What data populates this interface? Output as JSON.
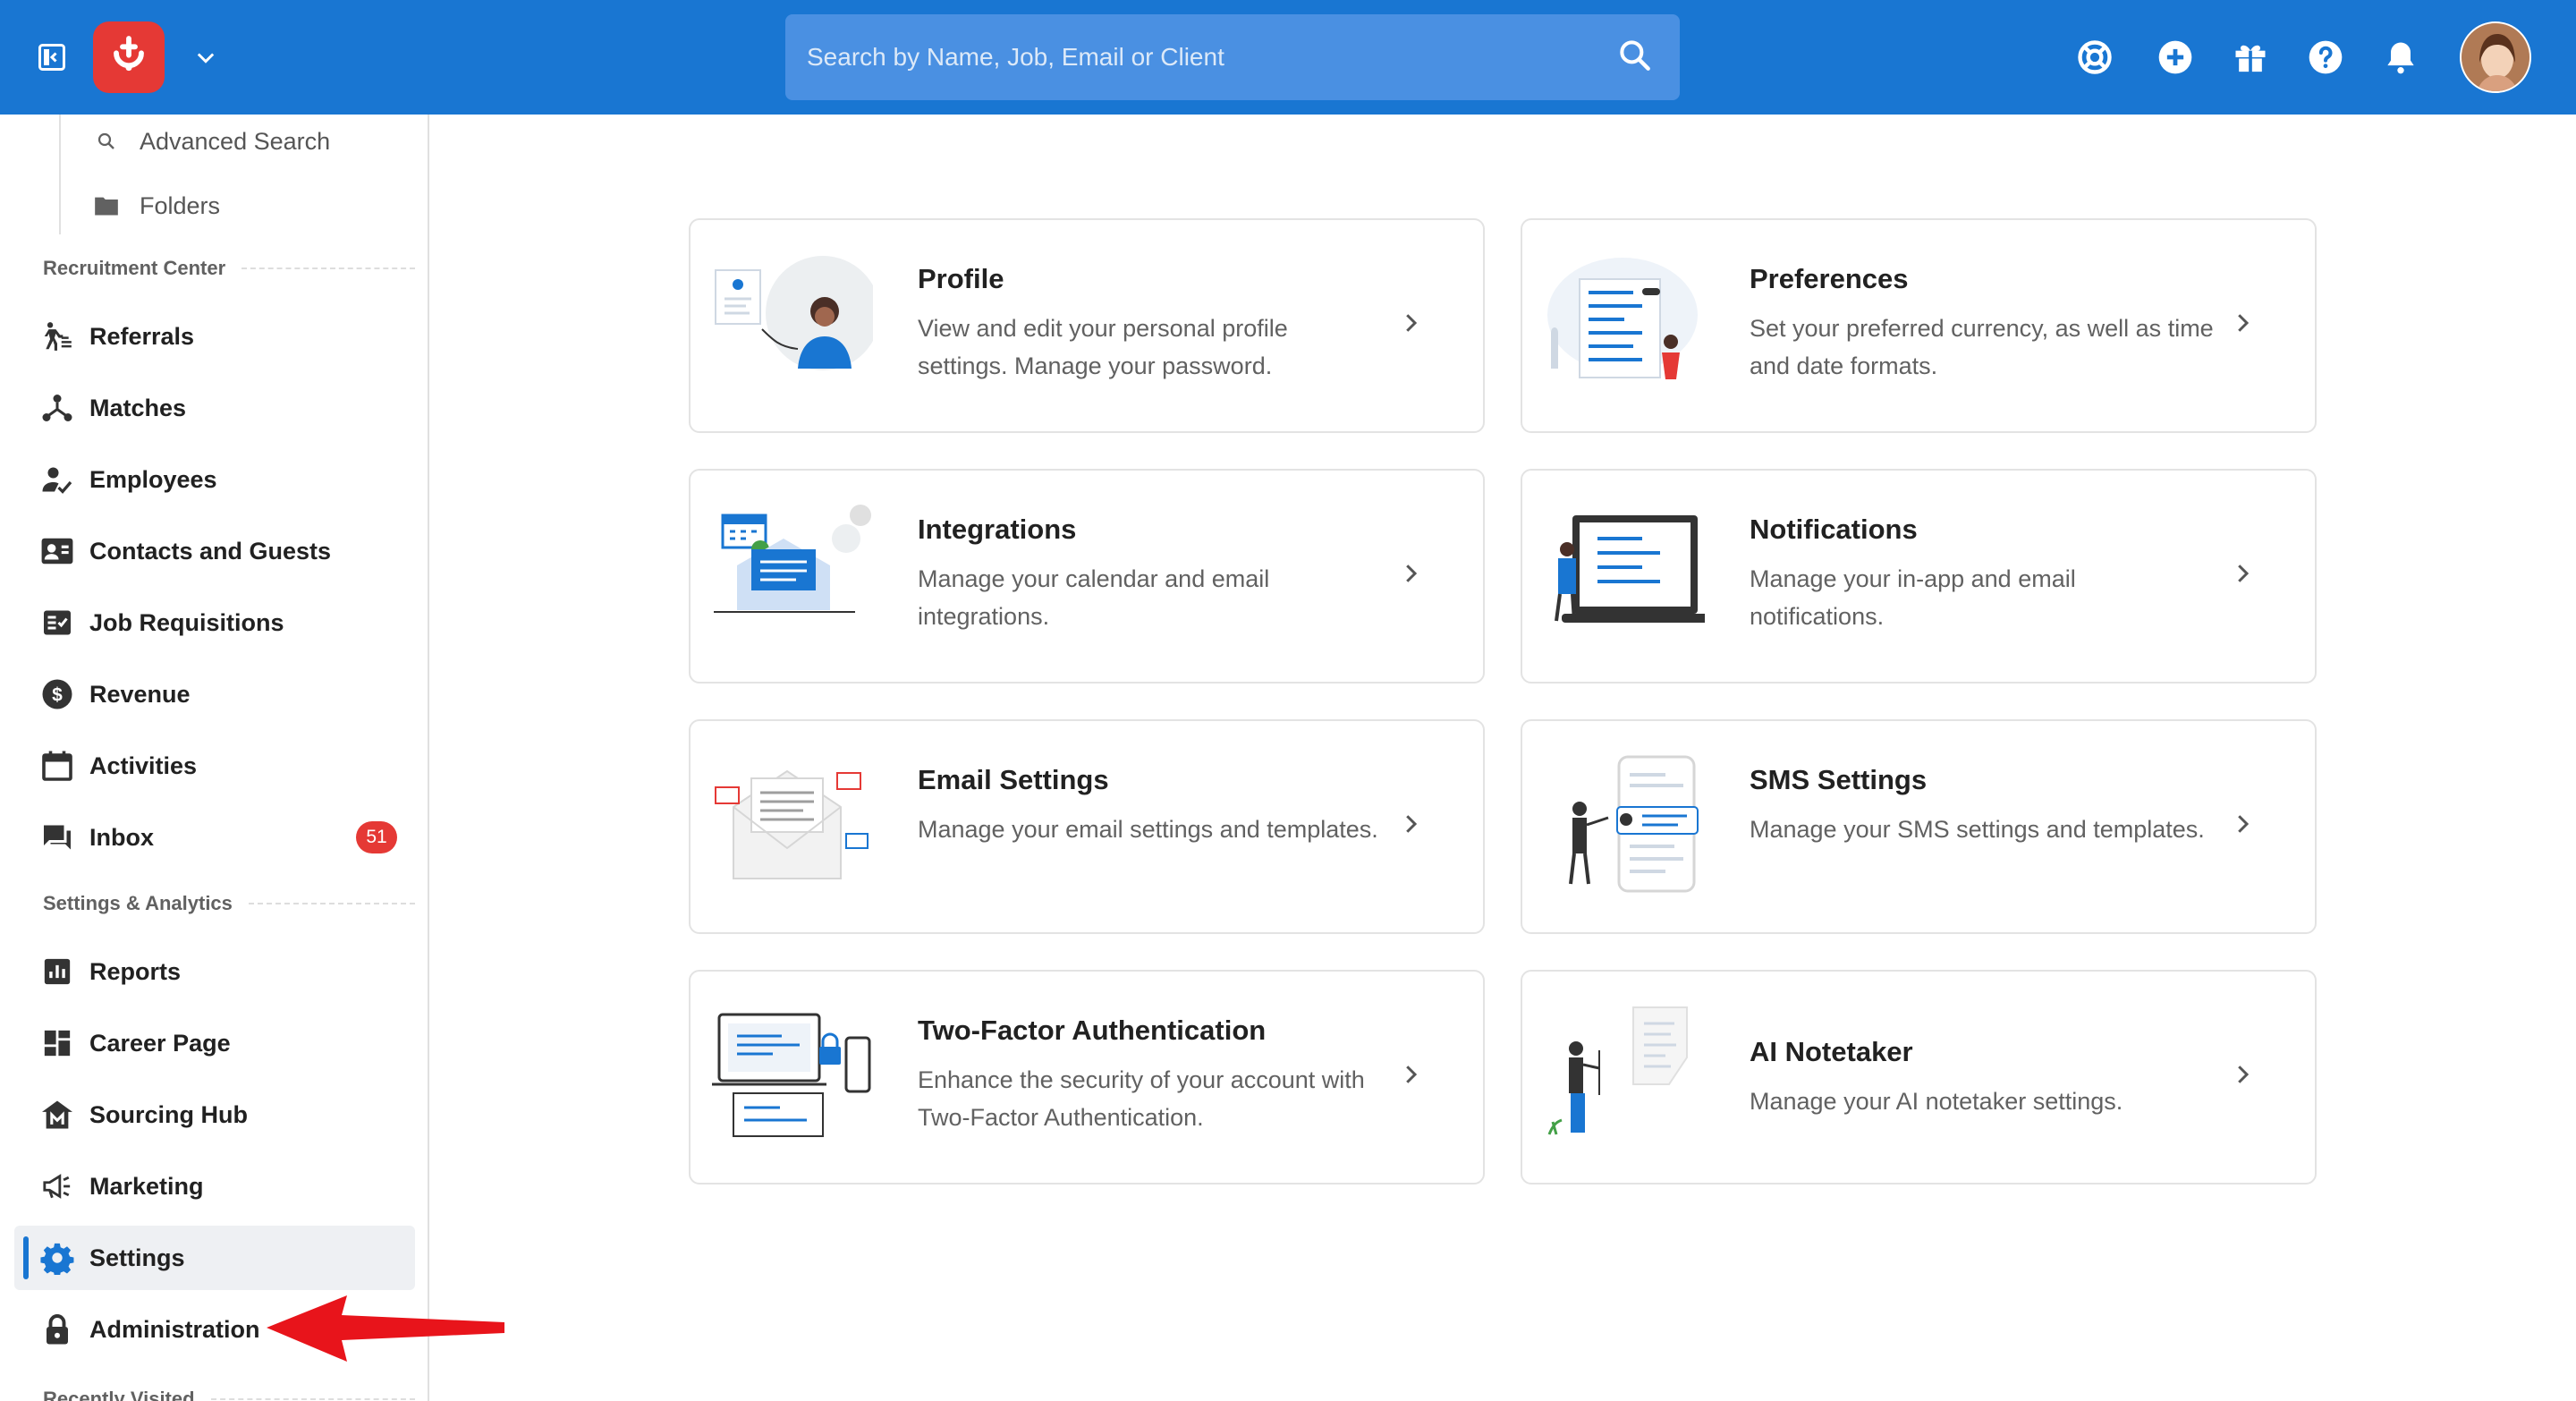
{
  "topbar": {
    "search_placeholder": "Search by Name, Job, Email or Client",
    "icons": [
      "sidebar-toggle-icon",
      "app-logo",
      "chevron-down-icon",
      "search-icon",
      "support-icon",
      "add-icon",
      "gift-icon",
      "help-icon",
      "bell-icon",
      "avatar"
    ]
  },
  "sidebar": {
    "sub_items": [
      {
        "label": "Advanced Search",
        "icon": "search-icon"
      },
      {
        "label": "Folders",
        "icon": "folder-icon"
      }
    ],
    "sections": {
      "recruitment": "Recruitment Center",
      "settings": "Settings & Analytics",
      "recent": "Recently Visited"
    },
    "recruitment_items": [
      {
        "label": "Referrals",
        "icon": "referrals-icon"
      },
      {
        "label": "Matches",
        "icon": "matches-icon"
      },
      {
        "label": "Employees",
        "icon": "employees-icon"
      },
      {
        "label": "Contacts and Guests",
        "icon": "contacts-icon"
      },
      {
        "label": "Job Requisitions",
        "icon": "job-requisitions-icon"
      },
      {
        "label": "Revenue",
        "icon": "revenue-icon"
      },
      {
        "label": "Activities",
        "icon": "calendar-icon"
      },
      {
        "label": "Inbox",
        "icon": "inbox-icon",
        "badge": "51"
      }
    ],
    "settings_items": [
      {
        "label": "Reports",
        "icon": "reports-icon"
      },
      {
        "label": "Career Page",
        "icon": "career-page-icon"
      },
      {
        "label": "Sourcing Hub",
        "icon": "sourcing-hub-icon"
      },
      {
        "label": "Marketing",
        "icon": "megaphone-icon"
      },
      {
        "label": "Settings",
        "icon": "gear-icon",
        "active": true
      },
      {
        "label": "Administration",
        "icon": "lock-icon"
      }
    ]
  },
  "cards": [
    {
      "title": "Profile",
      "desc": "View and edit your personal profile settings. Manage your password."
    },
    {
      "title": "Preferences",
      "desc": "Set your preferred currency, as well as time and date formats."
    },
    {
      "title": "Integrations",
      "desc": "Manage your calendar and email integrations."
    },
    {
      "title": "Notifications",
      "desc": "Manage your in-app and email notifications."
    },
    {
      "title": "Email Settings",
      "desc": "Manage your email settings and templates."
    },
    {
      "title": "SMS Settings",
      "desc": "Manage your SMS settings and templates."
    },
    {
      "title": "Two-Factor Authentication",
      "desc": "Enhance the security of your account with Two-Factor Authentication."
    },
    {
      "title": "AI Notetaker",
      "desc": "Manage your AI notetaker settings."
    }
  ],
  "colors": {
    "primary": "#1976d2",
    "logo": "#e53935",
    "badge": "#e53935",
    "annotation_arrow": "#e8141b"
  }
}
